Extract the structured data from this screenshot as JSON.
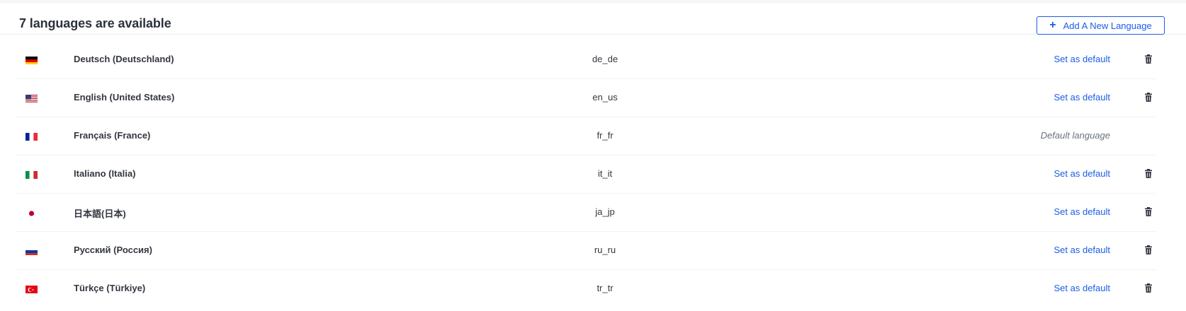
{
  "header": {
    "title": "7 languages are available",
    "add_button_label": "Add A New Language"
  },
  "languages": [
    {
      "name": "Deutsch (Deutschland)",
      "code": "de_de",
      "action": "Set as default",
      "is_default": false,
      "flag": "de-flag"
    },
    {
      "name": "English (United States)",
      "code": "en_us",
      "action": "Set as default",
      "is_default": false,
      "flag": "us-flag"
    },
    {
      "name": "Français (France)",
      "code": "fr_fr",
      "action": "Default language",
      "is_default": true,
      "flag": "fr-flag"
    },
    {
      "name": "Italiano (Italia)",
      "code": "it_it",
      "action": "Set as default",
      "is_default": false,
      "flag": "it-flag"
    },
    {
      "name": "日本語(日本)",
      "code": "ja_jp",
      "action": "Set as default",
      "is_default": false,
      "flag": "jp-flag"
    },
    {
      "name": "Русский (Россия)",
      "code": "ru_ru",
      "action": "Set as default",
      "is_default": false,
      "flag": "ru-flag"
    },
    {
      "name": "Türkçe (Türkiye)",
      "code": "tr_tr",
      "action": "Set as default",
      "is_default": false,
      "flag": "tr-flag"
    }
  ],
  "colors": {
    "accent": "#1c5de7",
    "text": "#333740",
    "muted": "#6b7280"
  }
}
